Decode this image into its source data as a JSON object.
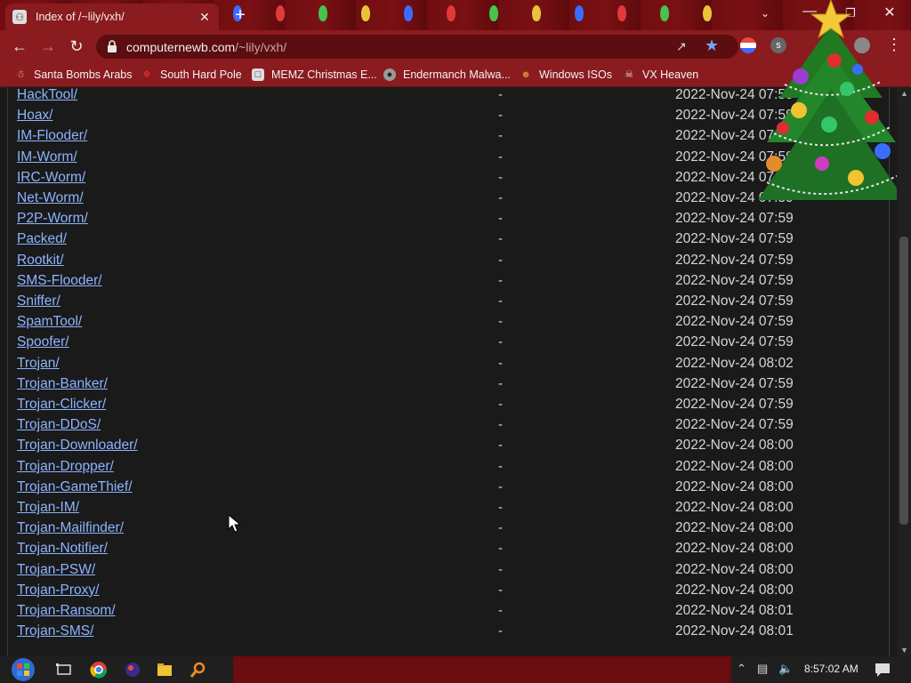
{
  "tab": {
    "title": "Index of /~lily/vxh/"
  },
  "omnibox": {
    "host": "computernewb.com",
    "path": "/~lily/vxh/"
  },
  "bookmarks": [
    {
      "label": "Santa Bombs Arabs",
      "icon": "santa-icon"
    },
    {
      "label": "South Hard Pole",
      "icon": "snowflake-icon"
    },
    {
      "label": "MEMZ Christmas E...",
      "icon": "window-icon"
    },
    {
      "label": "Endermanch Malwa...",
      "icon": "raccoon-icon"
    },
    {
      "label": "Windows ISOs",
      "icon": "gingerbread-icon"
    },
    {
      "label": "VX Heaven",
      "icon": "skull-icon"
    }
  ],
  "listing": [
    {
      "name": "HackTool/",
      "size": "-",
      "date": "2022-Nov-24 07:59"
    },
    {
      "name": "Hoax/",
      "size": "-",
      "date": "2022-Nov-24 07:59"
    },
    {
      "name": "IM-Flooder/",
      "size": "-",
      "date": "2022-Nov-24 07:59"
    },
    {
      "name": "IM-Worm/",
      "size": "-",
      "date": "2022-Nov-24 07:59"
    },
    {
      "name": "IRC-Worm/",
      "size": "-",
      "date": "2022-Nov-24 07:59"
    },
    {
      "name": "Net-Worm/",
      "size": "-",
      "date": "2022-Nov-24 07:59"
    },
    {
      "name": "P2P-Worm/",
      "size": "-",
      "date": "2022-Nov-24 07:59"
    },
    {
      "name": "Packed/",
      "size": "-",
      "date": "2022-Nov-24 07:59"
    },
    {
      "name": "Rootkit/",
      "size": "-",
      "date": "2022-Nov-24 07:59"
    },
    {
      "name": "SMS-Flooder/",
      "size": "-",
      "date": "2022-Nov-24 07:59"
    },
    {
      "name": "Sniffer/",
      "size": "-",
      "date": "2022-Nov-24 07:59"
    },
    {
      "name": "SpamTool/",
      "size": "-",
      "date": "2022-Nov-24 07:59"
    },
    {
      "name": "Spoofer/",
      "size": "-",
      "date": "2022-Nov-24 07:59"
    },
    {
      "name": "Trojan/",
      "size": "-",
      "date": "2022-Nov-24 08:02"
    },
    {
      "name": "Trojan-Banker/",
      "size": "-",
      "date": "2022-Nov-24 07:59"
    },
    {
      "name": "Trojan-Clicker/",
      "size": "-",
      "date": "2022-Nov-24 07:59"
    },
    {
      "name": "Trojan-DDoS/",
      "size": "-",
      "date": "2022-Nov-24 07:59"
    },
    {
      "name": "Trojan-Downloader/",
      "size": "-",
      "date": "2022-Nov-24 08:00"
    },
    {
      "name": "Trojan-Dropper/",
      "size": "-",
      "date": "2022-Nov-24 08:00"
    },
    {
      "name": "Trojan-GameThief/",
      "size": "-",
      "date": "2022-Nov-24 08:00"
    },
    {
      "name": "Trojan-IM/",
      "size": "-",
      "date": "2022-Nov-24 08:00"
    },
    {
      "name": "Trojan-Mailfinder/",
      "size": "-",
      "date": "2022-Nov-24 08:00"
    },
    {
      "name": "Trojan-Notifier/",
      "size": "-",
      "date": "2022-Nov-24 08:00"
    },
    {
      "name": "Trojan-PSW/",
      "size": "-",
      "date": "2022-Nov-24 08:00"
    },
    {
      "name": "Trojan-Proxy/",
      "size": "-",
      "date": "2022-Nov-24 08:00"
    },
    {
      "name": "Trojan-Ransom/",
      "size": "-",
      "date": "2022-Nov-24 08:01"
    },
    {
      "name": "Trojan-SMS/",
      "size": "-",
      "date": "2022-Nov-24 08:01"
    }
  ],
  "taskbar": {
    "clock": "8:57:02 AM"
  },
  "colors": {
    "chrome_red": "#8a1b1e",
    "link": "#8cb4ff",
    "page_bg": "#1a1a1a"
  }
}
